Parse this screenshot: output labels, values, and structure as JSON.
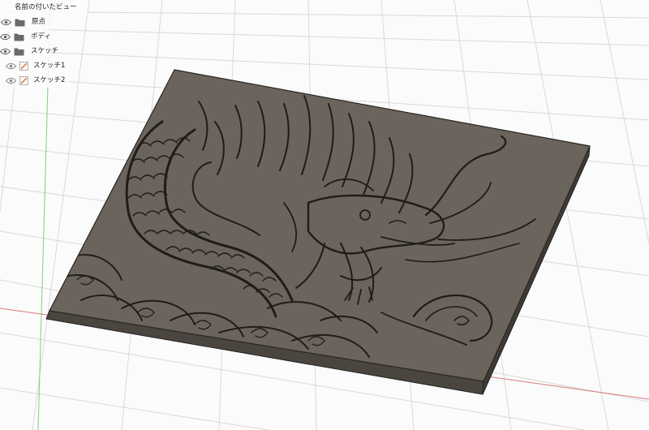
{
  "browser": {
    "named_views": "名前の付いたビュー",
    "items": [
      {
        "label": "原点",
        "icon": "folder-icon",
        "visible": true
      },
      {
        "label": "ボディ",
        "icon": "folder-icon",
        "visible": true
      },
      {
        "label": "スケッチ",
        "icon": "folder-icon",
        "visible": true
      }
    ],
    "sketches": [
      {
        "label": "スケッチ1",
        "icon": "sketch-icon"
      },
      {
        "label": "スケッチ2",
        "icon": "sketch-icon"
      }
    ]
  },
  "colors": {
    "background": "#fbfbfb",
    "grid": "#d9d9d9",
    "plate_top": "#6b645c",
    "plate_side": "#4a453f",
    "relief_line": "#222222",
    "x_axis": "#d87a7a",
    "y_axis": "#7fcf7f",
    "sketch_accent": "#e06a2a"
  }
}
